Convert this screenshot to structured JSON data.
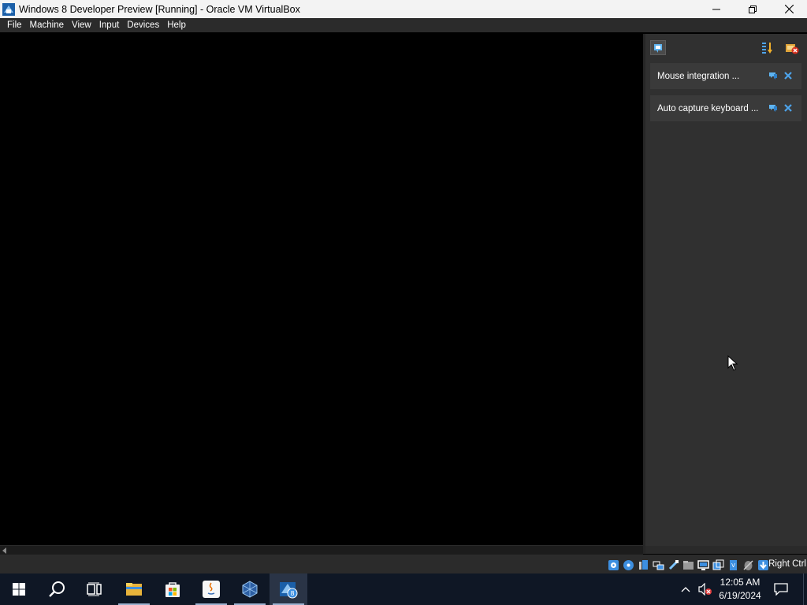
{
  "window": {
    "title": "Windows 8 Developer Preview [Running] - Oracle VM VirtualBox",
    "app_icon": "virtualbox-icon",
    "controls": [
      "minimize-icon",
      "maximize-icon",
      "close-icon"
    ]
  },
  "menubar": {
    "items": [
      "File",
      "Machine",
      "View",
      "Input",
      "Devices",
      "Help"
    ]
  },
  "notification_center": {
    "toolbar": [
      "pin-icon",
      "sort-icon",
      "clear-all-icon"
    ],
    "notifications": [
      {
        "text": "Mouse integration ..."
      },
      {
        "text": "Auto capture keyboard ..."
      }
    ]
  },
  "statusbar": {
    "icons": [
      "hard-disk-icon",
      "optical-drive-icon",
      "audio-icon",
      "network-icon",
      "usb-icon",
      "shared-folders-icon",
      "display-icon",
      "recording-icon",
      "cpu-icon",
      "mouse-integration-icon",
      "keyboard-icon"
    ],
    "host_key": "Right Ctrl"
  },
  "taskbar": {
    "items": [
      "start-icon",
      "search-icon",
      "task-view-icon",
      "file-explorer-icon",
      "microsoft-store-icon",
      "java-icon",
      "virtualbox-manager-icon",
      "virtualbox-vm-icon"
    ],
    "active_item": "virtualbox-vm-icon",
    "tray": [
      "show-hidden-icons-chevron",
      "volume-muted-icon"
    ],
    "time": "12:05 AM",
    "date": "6/19/2024"
  }
}
